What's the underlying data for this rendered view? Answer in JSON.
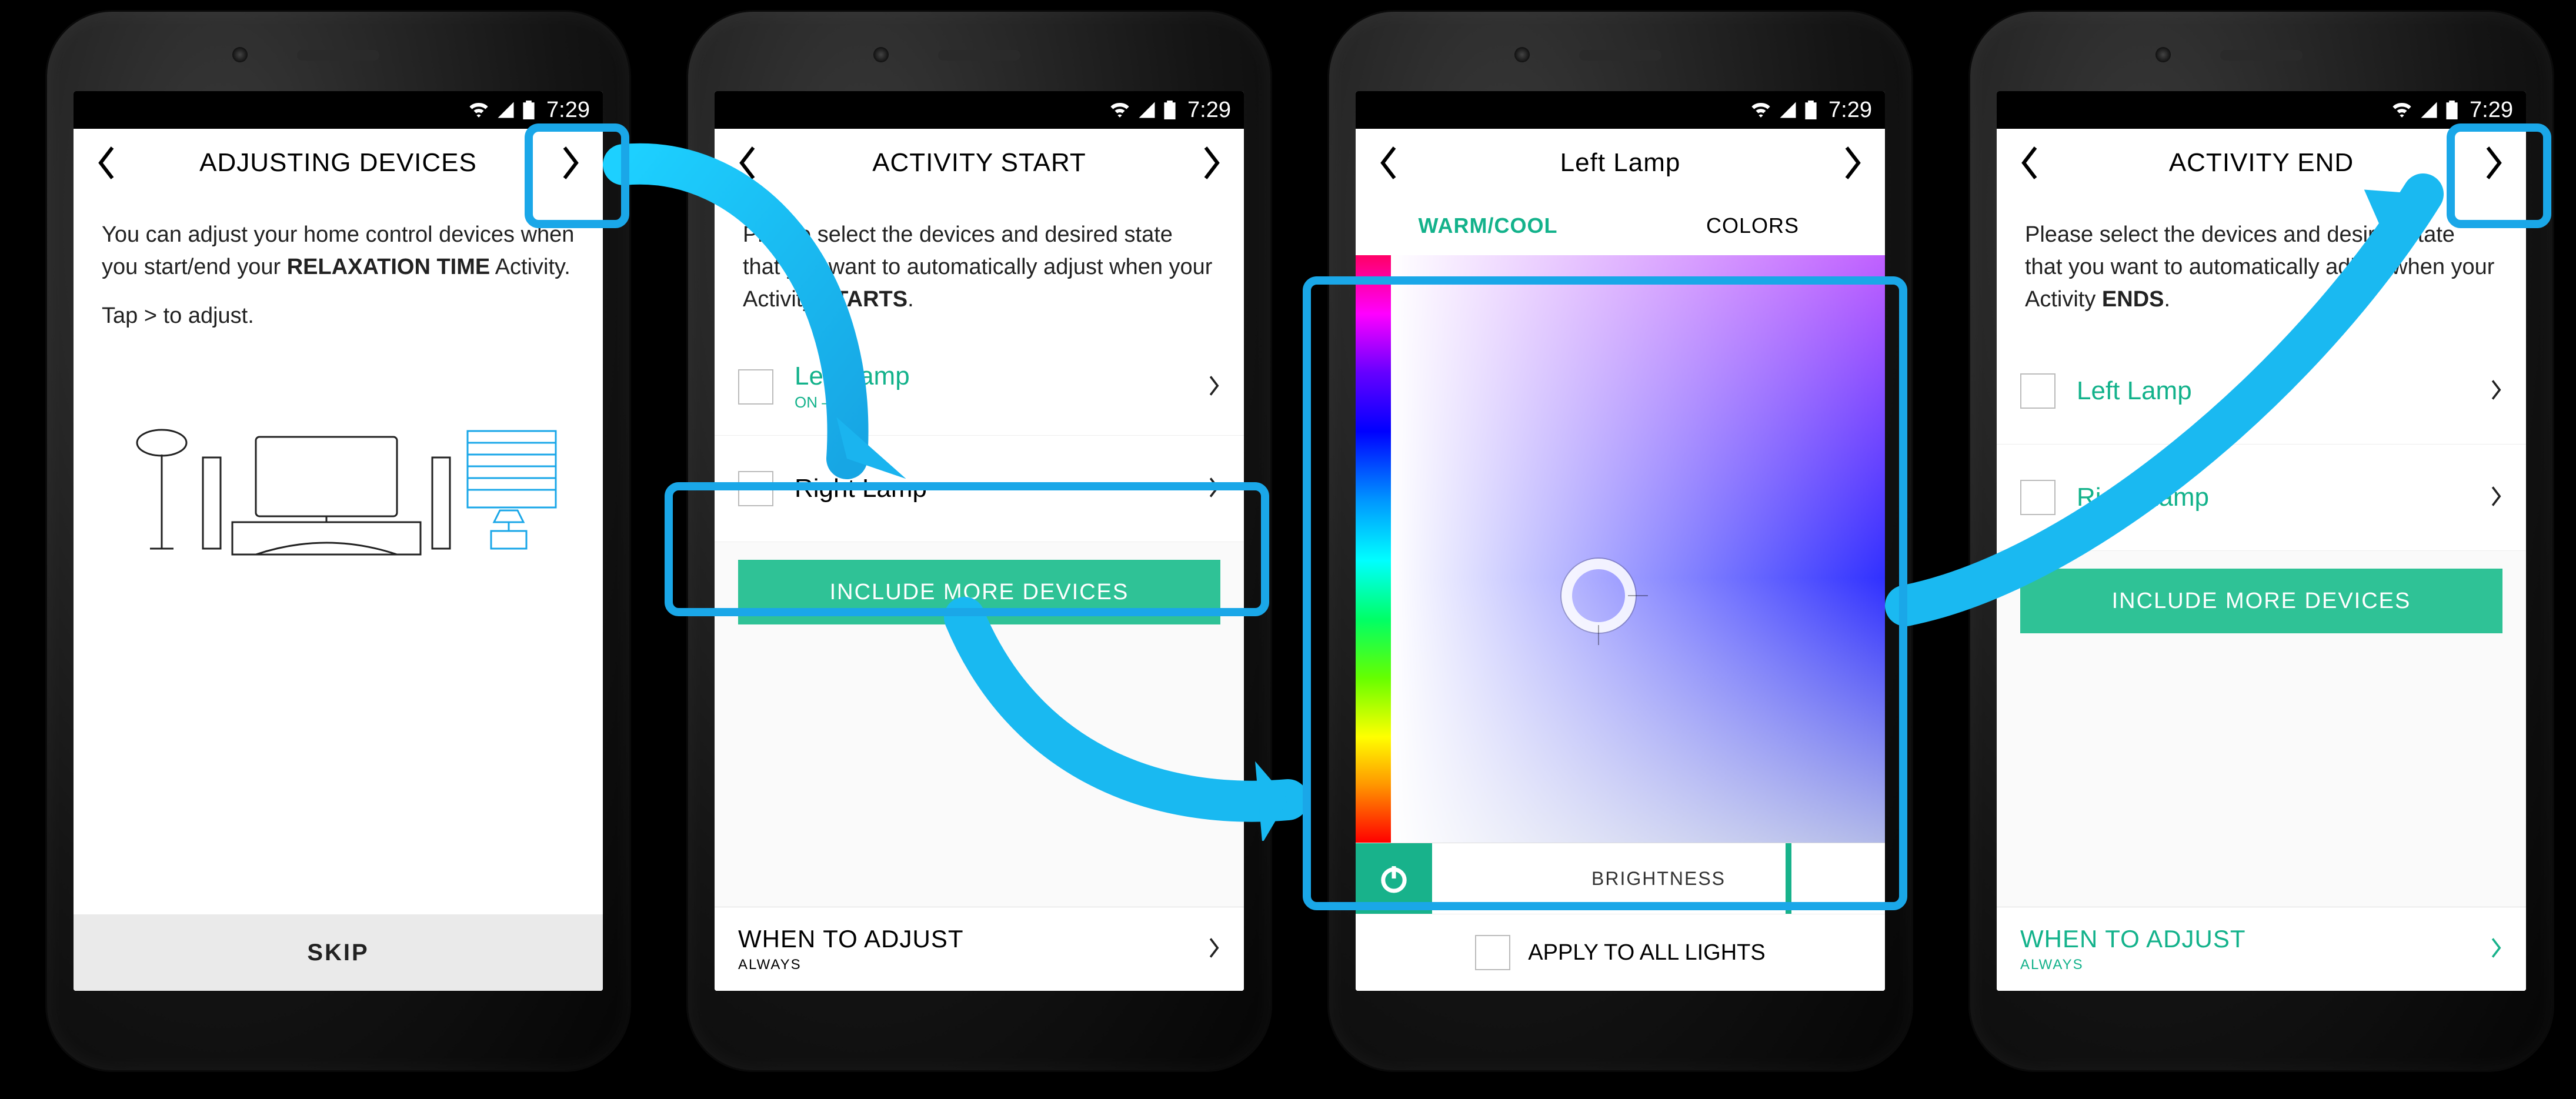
{
  "status": {
    "time": "7:29"
  },
  "screen1": {
    "title": "ADJUSTING DEVICES",
    "intro_a": "You can adjust your home control devices when you start/end your ",
    "intro_bold": "RELAXATION TIME",
    "intro_b": " Activity.",
    "tap": "Tap > to adjust.",
    "skip": "SKIP"
  },
  "screen2": {
    "title": "ACTIVITY START",
    "intro_a": "Please select the devices and desired state that you want to automatically adjust when your Activity ",
    "intro_bold": "STARTS",
    "intro_b": ".",
    "row1": {
      "label": "Left Lamp",
      "sub": "ON  – 80%"
    },
    "row2": {
      "label": "Right Lamp"
    },
    "include": "INCLUDE MORE DEVICES",
    "wta_title": "WHEN TO ADJUST",
    "wta_sub": "ALWAYS"
  },
  "screen3": {
    "title": "Left Lamp",
    "tab1": "WARM/COOL",
    "tab2": "COLORS",
    "brightness": "BRIGHTNESS",
    "apply": "APPLY TO ALL LIGHTS"
  },
  "screen4": {
    "title": "ACTIVITY END",
    "intro_a": "Please select the devices and desired state that you want to automatically adjust when your Activity ",
    "intro_bold": "ENDS",
    "intro_b": ".",
    "row1": {
      "label": "Left Lamp"
    },
    "row2": {
      "label": "Right Lamp"
    },
    "include": "INCLUDE MORE DEVICES",
    "wta_title": "WHEN TO ADJUST",
    "wta_sub": "ALWAYS"
  }
}
